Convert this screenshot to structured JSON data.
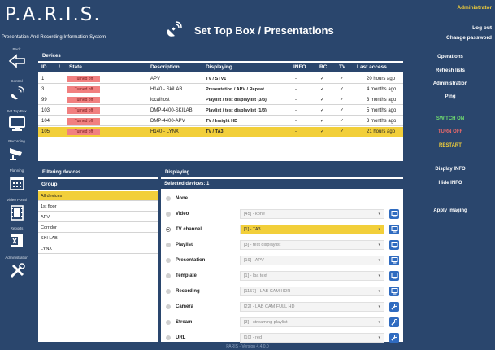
{
  "header": {
    "logo": "P.A.R.I.S.",
    "subtitle": "Presentation And Recording Information System",
    "page_title": "Set Top Box / Presentations",
    "user": "Administrator",
    "logout": "Log out",
    "change_password": "Change password",
    "icon": "satellite-dish-icon"
  },
  "sidebar": {
    "items": [
      {
        "label": "Back",
        "icon": "arrow-left-icon"
      },
      {
        "label": "Control",
        "icon": "satellite-icon"
      },
      {
        "label": "Set Top Box",
        "icon": "monitor-icon"
      },
      {
        "label": "Recording",
        "icon": "camera-icon"
      },
      {
        "label": "Planning",
        "icon": "calendar-icon"
      },
      {
        "label": "Video Portal",
        "icon": "film-icon"
      },
      {
        "label": "Reports",
        "icon": "excel-icon"
      },
      {
        "label": "Administration",
        "icon": "tools-icon"
      }
    ]
  },
  "devices": {
    "title": "Devices",
    "columns": [
      "ID",
      "!",
      "State",
      "Description",
      "Displaying",
      "INFO",
      "RC",
      "TV",
      "Last access"
    ],
    "rows": [
      {
        "id": "1",
        "state": "Turned off",
        "description": "APV",
        "displaying": "TV / STV1",
        "info": "-",
        "rc": "✓",
        "tv": "✓",
        "last": "20 hours ago"
      },
      {
        "id": "3",
        "state": "Turned off",
        "description": "H140 - SkiLAB",
        "displaying": "Presentation / APV / Repeat",
        "info": "-",
        "rc": "✓",
        "tv": "✓",
        "last": "4 months ago"
      },
      {
        "id": "99",
        "state": "Turned off",
        "description": "localhost",
        "displaying": "Playlist / test displaylist (3/3)",
        "info": "-",
        "rc": "✓",
        "tv": "✓",
        "last": "3 months ago"
      },
      {
        "id": "103",
        "state": "Turned off",
        "description": "DMP-4400-SKILAB",
        "displaying": "Playlist / test displaylist (1/3)",
        "info": "-",
        "rc": "✓",
        "tv": "✓",
        "last": "5 months ago"
      },
      {
        "id": "104",
        "state": "Turned off",
        "description": "DMP-4400-APV",
        "displaying": "TV / Insight HD",
        "info": "-",
        "rc": "✓",
        "tv": "✓",
        "last": "3 months ago"
      },
      {
        "id": "105",
        "state": "Turned off",
        "description": "H140 - LYNX",
        "displaying": "TV / TA3",
        "info": "-",
        "rc": "✓",
        "tv": "✓",
        "last": "21 hours ago"
      }
    ]
  },
  "filtering": {
    "title": "Filtering devices",
    "group_header": "Group",
    "groups": [
      "All devices",
      "1st floor",
      "APV",
      "Corridor",
      "SKI LAB",
      "LYNX"
    ]
  },
  "displaying": {
    "title": "Displaying",
    "selected": "Selected devices: 1",
    "options": [
      {
        "label": "None",
        "value": "",
        "selected": false,
        "button": ""
      },
      {
        "label": "Video",
        "value": "[45] - kone",
        "selected": false,
        "button": "monitor-icon"
      },
      {
        "label": "TV channel",
        "value": "[1] - TA3",
        "selected": true,
        "button": "monitor-icon"
      },
      {
        "label": "Playlist",
        "value": "[3] - test displaylist",
        "selected": false,
        "button": "monitor-icon"
      },
      {
        "label": "Presentation",
        "value": "[19] - APV",
        "selected": false,
        "button": "monitor-icon"
      },
      {
        "label": "Template",
        "value": "[1] - lba text",
        "selected": false,
        "button": "monitor-icon"
      },
      {
        "label": "Recording",
        "value": "[1157] - LAB CAM HDR",
        "selected": false,
        "button": "monitor-icon"
      },
      {
        "label": "Camera",
        "value": "[22] - LAB CAM FULL HD",
        "selected": false,
        "button": "wrench-icon"
      },
      {
        "label": "Stream",
        "value": "[3] - streaming playlist",
        "selected": false,
        "button": "wrench-icon"
      },
      {
        "label": "URL",
        "value": "[10] - red",
        "selected": false,
        "button": "wrench-icon"
      }
    ]
  },
  "operations": {
    "title": "Operations",
    "buttons": [
      "Refresh lists",
      "Administration",
      "Ping",
      "SWITCH ON",
      "TURN OFF",
      "RESTART",
      "Display INFO",
      "Hide INFO",
      "Apply imaging"
    ]
  },
  "footer": "PARIS - Version 4.4.0.0",
  "colors": {
    "navy": "#2a466d",
    "highlight": "#f2cf3a",
    "off": "#f18080",
    "on": "#6fdc6f",
    "blue_button": "#2f6bc0"
  }
}
